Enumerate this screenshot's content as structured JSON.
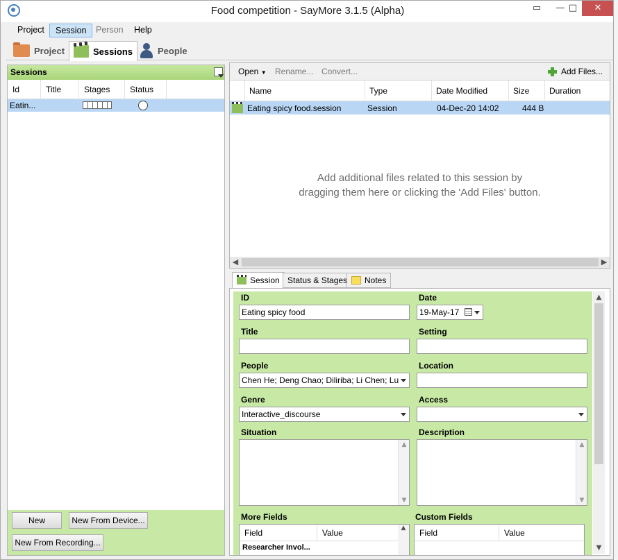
{
  "window": {
    "title": "Food competition - SayMore 3.1.5 (Alpha)",
    "controls": {
      "minimize": "—",
      "maximize": "□",
      "close": "✕"
    }
  },
  "menu": {
    "items": [
      {
        "label": "Project",
        "state": "normal"
      },
      {
        "label": "Session",
        "state": "active"
      },
      {
        "label": "Person",
        "state": "disabled"
      },
      {
        "label": "Help",
        "state": "normal"
      }
    ]
  },
  "view_tabs": [
    {
      "label": "Project",
      "icon": "folder-icon"
    },
    {
      "label": "Sessions",
      "icon": "clapperboard-icon",
      "active": true
    },
    {
      "label": "People",
      "icon": "person-icon"
    }
  ],
  "sessions_panel": {
    "header": "Sessions",
    "columns": [
      "Id",
      "Title",
      "Stages",
      "Status"
    ],
    "rows": [
      {
        "id": "Eatin..."
      }
    ],
    "buttons": {
      "new": "New",
      "new_from_device": "New From Device...",
      "new_from_recording": "New From Recording..."
    }
  },
  "files_panel": {
    "toolbar": {
      "open": "Open",
      "rename": "Rename...",
      "convert": "Convert...",
      "add_files": "Add Files..."
    },
    "columns": [
      "Name",
      "Type",
      "Date Modified",
      "Size",
      "Duration"
    ],
    "rows": [
      {
        "name": "Eating spicy food.session",
        "type": "Session",
        "date": "04-Dec-20 14:02",
        "size": "444 B",
        "duration": ""
      }
    ],
    "empty_message_line1": "Add additional files related to this session by",
    "empty_message_line2": "dragging them here or clicking the 'Add Files' button."
  },
  "detail_tabs": [
    {
      "label": "Session",
      "active": true
    },
    {
      "label": "Status & Stages"
    },
    {
      "label": "Notes"
    }
  ],
  "session_form": {
    "id_label": "ID",
    "id_value": "Eating spicy food",
    "date_label": "Date",
    "date_value": "19-May-17",
    "title_label": "Title",
    "title_value": "",
    "setting_label": "Setting",
    "setting_value": "",
    "people_label": "People",
    "people_value": "Chen He; Deng Chao; Diliriba; Li Chen; Lu",
    "location_label": "Location",
    "location_value": "",
    "genre_label": "Genre",
    "genre_value": "Interactive_discourse",
    "access_label": "Access",
    "access_value": "",
    "situation_label": "Situation",
    "description_label": "Description",
    "more_fields_label": "More Fields",
    "custom_fields_label": "Custom Fields",
    "more_fields_columns": [
      "Field",
      "Value"
    ],
    "custom_fields_columns": [
      "Field",
      "Value"
    ],
    "more_fields_first_row": "Researcher Invol..."
  },
  "colors": {
    "accent_green": "#c8e9a5",
    "selection_blue": "#b9d7f5",
    "close_red": "#c75050"
  }
}
